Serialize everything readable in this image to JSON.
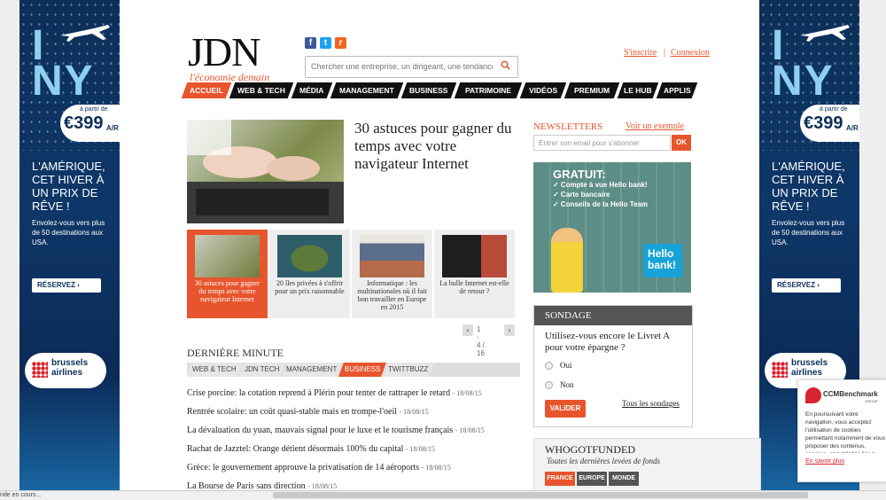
{
  "skin_ad": {
    "brand_text": "I NY",
    "from_label": "à partir de",
    "price": "€399",
    "price_suffix": "A/R",
    "headline": "L'AMÉRIQUE, CET HIVER À UN PRIX DE RÊVE !",
    "subtext": "Envolez-vous vers plus de 50 destinations aux USA.",
    "cta": "RÉSERVEZ",
    "airline": "brussels airlines"
  },
  "header": {
    "logo": "JDN",
    "tagline": "l'économie demain",
    "search_placeholder": "Chercher une entreprise, un dirigeant, une tendance",
    "signup": "S'inscrire",
    "login": "Connexion",
    "separator": "|"
  },
  "nav": [
    "ACCUEIL",
    "WEB & TECH",
    "MÉDIA",
    "MANAGEMENT",
    "BUSINESS",
    "PATRIMOINE",
    "VIDÉOS",
    "PREMIUM",
    "LE HUB",
    "APPLIS"
  ],
  "hero": {
    "title": "30 astuces pour gagner du temps avec votre navigateur Internet"
  },
  "carousel": {
    "items": [
      "30 astuces pour gagner du temps avec votre navigateur Internet",
      "20 îles privées à s'offrir pour un prix raisonnable",
      "Informatique : les multinationales où il fait bon travailler en Europe en 2015",
      "La bulle Internet est-elle de retour ?"
    ],
    "pager": "1 - 4 / 16",
    "prev": "‹",
    "next": "›"
  },
  "latest": {
    "title": "DERNIÈRE MINUTE",
    "tabs": [
      "WEB & TECH",
      "JDN TECH",
      "MANAGEMENT",
      "BUSINESS",
      "TWITTBUZZ"
    ],
    "active_tab": 3,
    "items": [
      {
        "text": "Crise porcine: la cotation reprend à Plérin pour tenter de rattraper le retard",
        "date": "- 18/08/15"
      },
      {
        "text": "Rentrée scolaire: un coût quasi-stable mais en trompe-l'oeil",
        "date": "- 18/08/15"
      },
      {
        "text": "La dévaluation du yuan, mauvais signal pour le luxe et le tourisme français",
        "date": "- 18/08/15"
      },
      {
        "text": "Rachat de Jazztel: Orange détient désormais 100% du capital",
        "date": "- 18/08/15"
      },
      {
        "text": "Grèce: le gouvernement approuve la privatisation de 14 aéroports",
        "date": "- 18/08/15"
      },
      {
        "text": "La Bourse de Paris sans direction",
        "date": "- 18/08/15"
      }
    ]
  },
  "newsletter": {
    "title": "NEWSLETTERS",
    "example_link": "Voir un exemple",
    "email_placeholder": "Entrer son email pour s'abonner",
    "ok": "OK"
  },
  "bank_ad": {
    "headline": "GRATUIT:",
    "lines": [
      "✓ Compte à vue Hello bank!",
      "✓ Carte bancaire",
      "✓ Conseils de la Hello Team"
    ],
    "brand": "Hello bank!"
  },
  "poll": {
    "title": "SONDAGE",
    "question": "Utilisez-vous encore le Livret A pour votre épargne ?",
    "options": [
      "Oui",
      "Non"
    ],
    "submit": "VALIDER",
    "all_link": "Tous les sondages"
  },
  "whogotfunded": {
    "title": "WHOGOTFUNDED",
    "subtitle": "Toutes les dernières levées de fonds",
    "tabs": [
      "FRANCE",
      "EUROPE",
      "MONDE"
    ]
  },
  "ccm": {
    "name": "CCMBenchmark",
    "group": "GROUP",
    "text": "En poursuivant votre navigation, vous acceptez l'utilisation de cookies permettant notamment de vous proposer des contenus, services, et publicités liés à vos centres d'intérêt.",
    "link": "En savoir plus"
  },
  "statusbar": {
    "text": "nde en cours..."
  },
  "colors": {
    "accent": "#e8552c",
    "nav_bg": "#111111",
    "skin_bg": "#0e3768"
  }
}
